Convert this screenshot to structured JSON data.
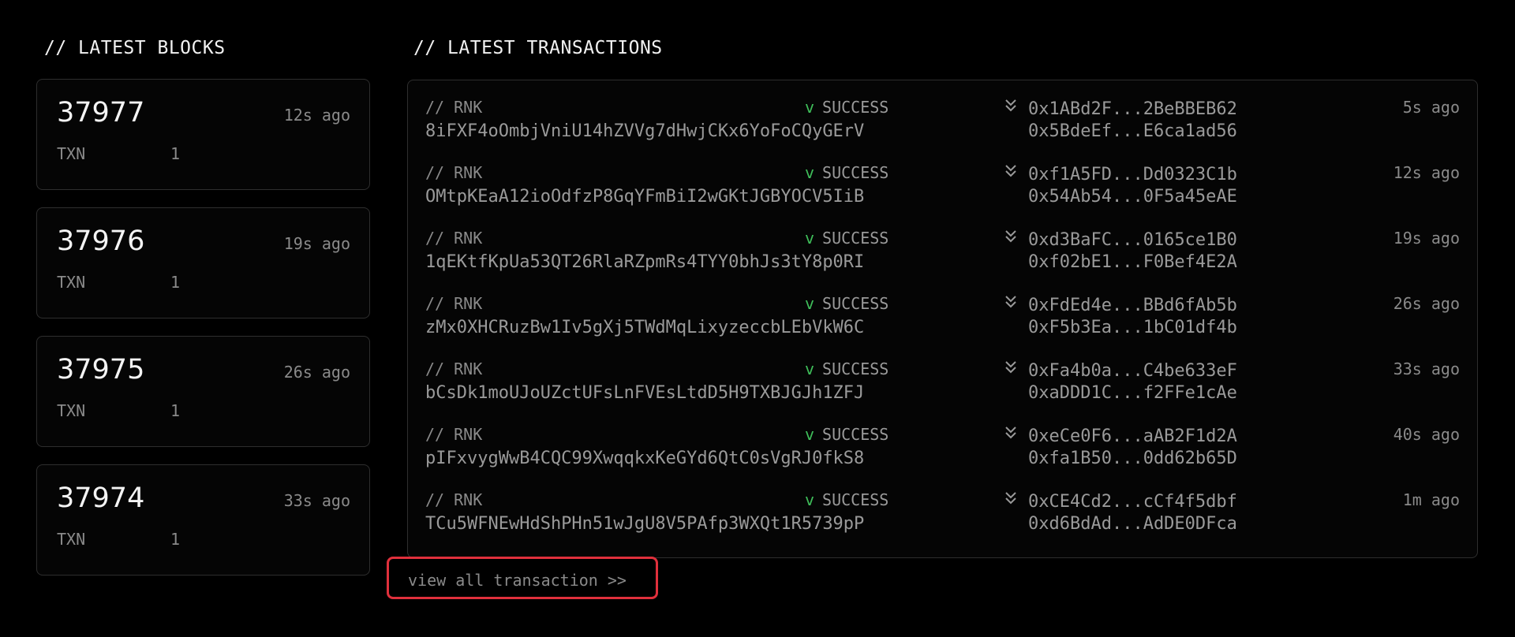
{
  "blocks_section": {
    "title": "// LATEST BLOCKS",
    "items": [
      {
        "number": "37977",
        "age": "12s ago",
        "txn_label": "TXN",
        "txn_count": "1"
      },
      {
        "number": "37976",
        "age": "19s ago",
        "txn_label": "TXN",
        "txn_count": "1"
      },
      {
        "number": "37975",
        "age": "26s ago",
        "txn_label": "TXN",
        "txn_count": "1"
      },
      {
        "number": "37974",
        "age": "33s ago",
        "txn_label": "TXN",
        "txn_count": "1"
      }
    ]
  },
  "transactions_section": {
    "title": "// LATEST TRANSACTIONS",
    "items": [
      {
        "type": "// RNK",
        "hash": "8iFXF4oOmbjVniU14hZVVg7dHwjCKx6YoFoCQyGErV",
        "status_mark": "v",
        "status": "SUCCESS",
        "from": "0x1ABd2F...2BeBBEB62",
        "to": "0x5BdeEf...E6ca1ad56",
        "age": "5s ago"
      },
      {
        "type": "// RNK",
        "hash": "OMtpKEaA12ioOdfzP8GqYFmBiI2wGKtJGBYOCV5IiB",
        "status_mark": "v",
        "status": "SUCCESS",
        "from": "0xf1A5FD...Dd0323C1b",
        "to": "0x54Ab54...0F5a45eAE",
        "age": "12s ago"
      },
      {
        "type": "// RNK",
        "hash": "1qEKtfKpUa53QT26RlaRZpmRs4TYY0bhJs3tY8p0RI",
        "status_mark": "v",
        "status": "SUCCESS",
        "from": "0xd3BaFC...0165ce1B0",
        "to": "0xf02bE1...F0Bef4E2A",
        "age": "19s ago"
      },
      {
        "type": "// RNK",
        "hash": "zMx0XHCRuzBw1Iv5gXj5TWdMqLixyzeccbLEbVkW6C",
        "status_mark": "v",
        "status": "SUCCESS",
        "from": "0xFdEd4e...BBd6fAb5b",
        "to": "0xF5b3Ea...1bC01df4b",
        "age": "26s ago"
      },
      {
        "type": "// RNK",
        "hash": "bCsDk1moUJoUZctUFsLnFVEsLtdD5H9TXBJGJh1ZFJ",
        "status_mark": "v",
        "status": "SUCCESS",
        "from": "0xFa4b0a...C4be633eF",
        "to": "0xaDDD1C...f2FFe1cAe",
        "age": "33s ago"
      },
      {
        "type": "// RNK",
        "hash": "pIFxvygWwB4CQC99XwqqkxKeGYd6QtC0sVgRJ0fkS8",
        "status_mark": "v",
        "status": "SUCCESS",
        "from": "0xeCe0F6...aAB2F1d2A",
        "to": "0xfa1B50...0dd62b65D",
        "age": "40s ago"
      },
      {
        "type": "// RNK",
        "hash": "TCu5WFNEwHdShPHn51wJgU8V5PAfp3WXQt1R5739pP",
        "status_mark": "v",
        "status": "SUCCESS",
        "from": "0xCE4Cd2...cCf4f5dbf",
        "to": "0xd6BdAd...AdDE0DFca",
        "age": "1m ago"
      }
    ],
    "view_all_label": "view all transaction >>"
  },
  "icons": {
    "transfer_arrow": "double-chevron-down-icon"
  },
  "colors": {
    "background": "#000000",
    "card_border": "#2e2e2e",
    "success": "#3fbf5a",
    "highlight_border": "#e0303c",
    "muted_text": "#8a8a8a"
  }
}
